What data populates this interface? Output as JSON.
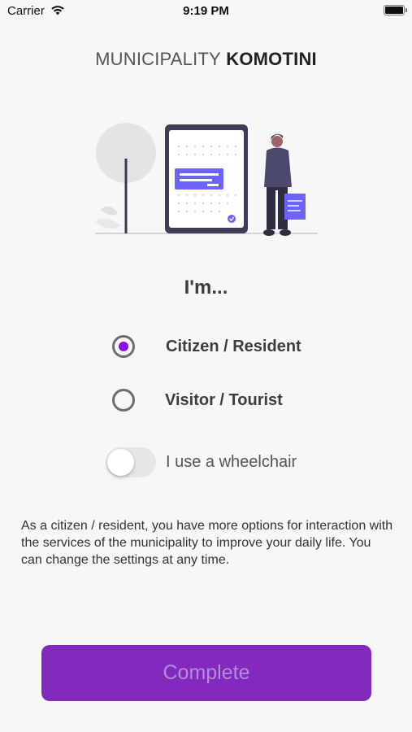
{
  "status_bar": {
    "carrier": "Carrier",
    "time": "9:19 PM",
    "wifi_icon": "wifi-icon",
    "battery_icon": "battery-icon"
  },
  "header": {
    "brand_light": "MUNICIPALITY",
    "brand_bold": "KOMOTINI"
  },
  "illustration": {
    "icon": "person-with-tablet-illustration",
    "accent_color": "#6c63ff"
  },
  "question": {
    "heading": "I'm..."
  },
  "options": [
    {
      "label": "Citizen / Resident",
      "selected": true
    },
    {
      "label": "Visitor / Tourist",
      "selected": false
    }
  ],
  "wheelchair": {
    "label": "I use a wheelchair",
    "enabled": false
  },
  "description": "As a citizen / resident, you have more options for interaction with the services of the municipality to improve your daily life. You can change the settings at any time.",
  "actions": {
    "complete_label": "Complete"
  },
  "colors": {
    "accent": "#8229be",
    "radio_selected": "#8a12e9",
    "background": "#f7f7f7"
  }
}
